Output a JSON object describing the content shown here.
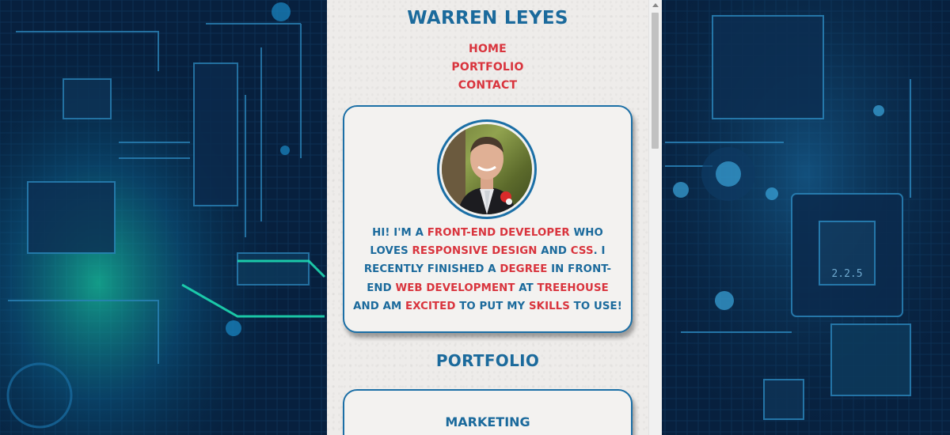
{
  "site": {
    "title": "WARREN LEYES"
  },
  "nav": {
    "items": [
      "HOME",
      "PORTFOLIO",
      "CONTACT"
    ]
  },
  "about": {
    "intro": [
      {
        "t": "HI! I'M A ",
        "h": false
      },
      {
        "t": "FRONT-END DEVELOPER",
        "h": true
      },
      {
        "t": " WHO LOVES ",
        "h": false
      },
      {
        "t": "RESPONSIVE DESIGN",
        "h": true
      },
      {
        "t": " AND ",
        "h": false
      },
      {
        "t": "CSS",
        "h": true
      },
      {
        "t": ". I RECENTLY FINISHED A ",
        "h": false
      },
      {
        "t": "DEGREE",
        "h": true
      },
      {
        "t": " IN FRONT-END ",
        "h": false
      },
      {
        "t": "WEB DEVELOPMENT",
        "h": true
      },
      {
        "t": " AT ",
        "h": false
      },
      {
        "t": "TREEHOUSE",
        "h": true
      },
      {
        "t": " AND AM ",
        "h": false
      },
      {
        "t": "EXCITED",
        "h": true
      },
      {
        "t": " TO PUT MY ",
        "h": false
      },
      {
        "t": "SKILLS",
        "h": true
      },
      {
        "t": " TO USE!",
        "h": false
      }
    ]
  },
  "portfolio": {
    "title": "PORTFOLIO",
    "first_card_heading": "MARKETING"
  },
  "backdrop": {
    "chip_label": "2.2.5"
  },
  "colors": {
    "primary": "#1b6a9c",
    "accent": "#d9343d",
    "panel": "#eeecea"
  }
}
